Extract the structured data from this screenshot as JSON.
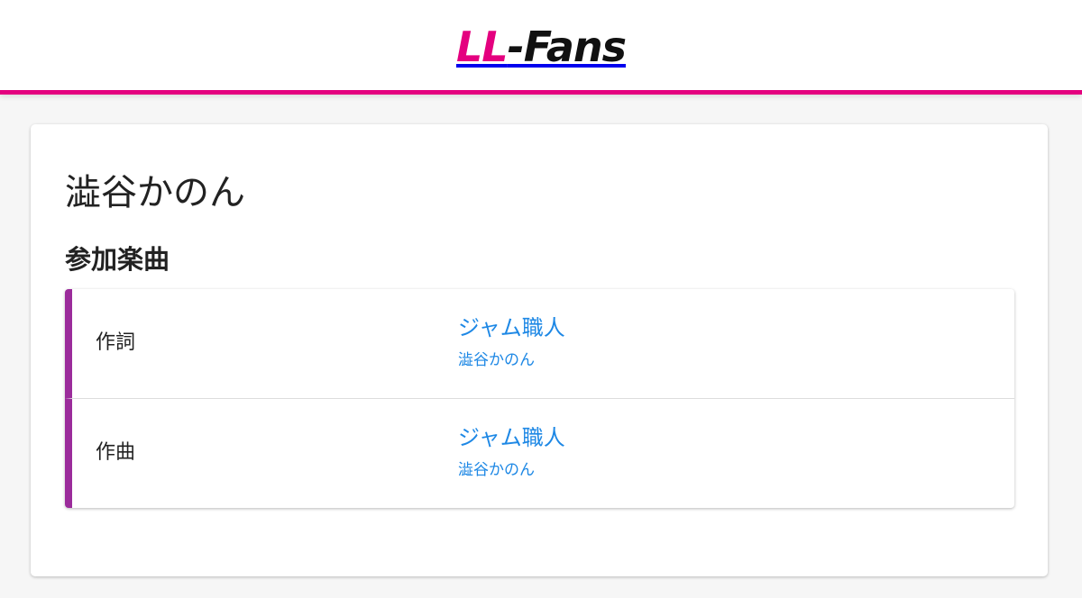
{
  "header": {
    "logo_ll": "LL",
    "logo_rest": "-Fans"
  },
  "main": {
    "title": "澁谷かのん",
    "section_title": "参加楽曲",
    "songs": [
      {
        "role": "作詞",
        "title": "ジャム職人",
        "artist": "澁谷かのん"
      },
      {
        "role": "作曲",
        "title": "ジャム職人",
        "artist": "澁谷かのん"
      }
    ]
  },
  "colors": {
    "brand": "#e4007f",
    "row_accent": "#9b2c9b",
    "link": "#1e88e5"
  }
}
